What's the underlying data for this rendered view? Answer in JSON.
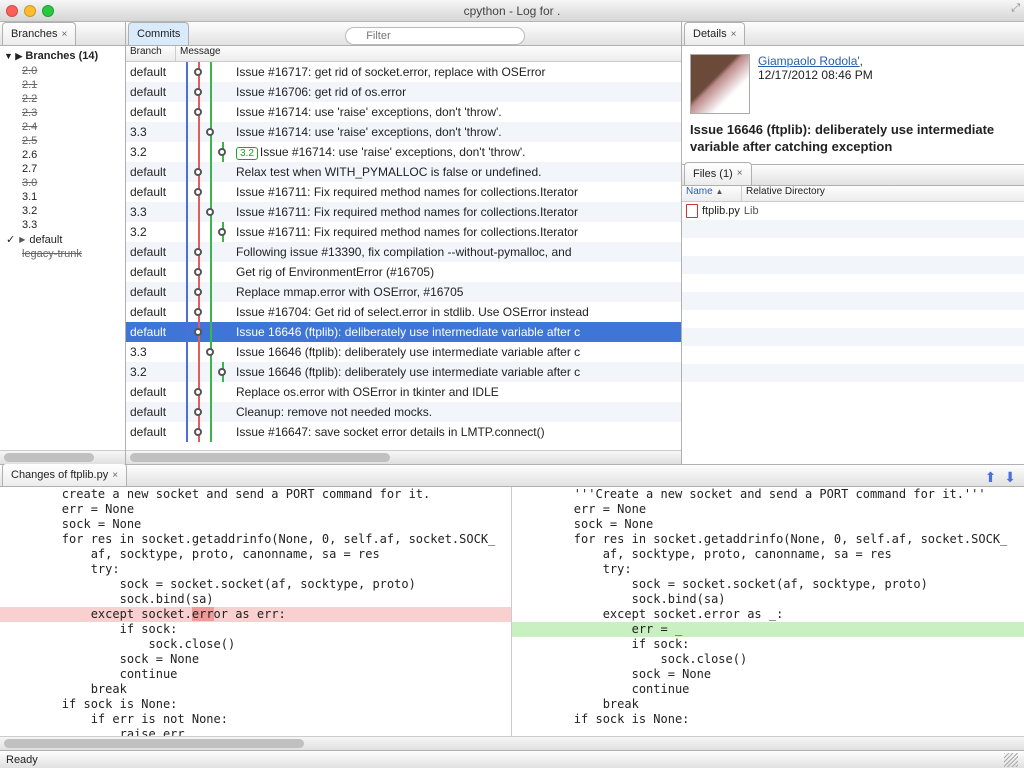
{
  "window": {
    "title": "cpython - Log for ."
  },
  "branches_panel": {
    "tab": "Branches",
    "header": "Branches (14)",
    "items": [
      {
        "label": "2.0",
        "strike": true
      },
      {
        "label": "2.1",
        "strike": true
      },
      {
        "label": "2.2",
        "strike": true
      },
      {
        "label": "2.3",
        "strike": true
      },
      {
        "label": "2.4",
        "strike": true
      },
      {
        "label": "2.5",
        "strike": true
      },
      {
        "label": "2.6",
        "strike": false
      },
      {
        "label": "2.7",
        "strike": false
      },
      {
        "label": "3.0",
        "strike": true
      },
      {
        "label": "3.1",
        "strike": false
      },
      {
        "label": "3.2",
        "strike": false
      },
      {
        "label": "3.3",
        "strike": false
      },
      {
        "label": "default",
        "strike": false,
        "checked": true,
        "disc": true
      },
      {
        "label": "legacy-trunk",
        "strike": true
      }
    ]
  },
  "commits_panel": {
    "tab": "Commits",
    "filter_placeholder": "Filter",
    "cols": {
      "branch": "Branch",
      "message": "Message"
    },
    "rows": [
      {
        "branch": "default",
        "msg": "Issue #16717: get rid of socket.error, replace with OSError",
        "node": 2
      },
      {
        "branch": "default",
        "msg": "Issue #16706: get rid of os.error",
        "node": 2
      },
      {
        "branch": "default",
        "msg": "Issue #16714: use 'raise' exceptions, don't 'throw'.",
        "node": 2
      },
      {
        "branch": "3.3",
        "msg": "Issue #16714: use 'raise' exceptions, don't 'throw'.",
        "node": 3
      },
      {
        "branch": "3.2",
        "badge": "3.2",
        "msg": "Issue #16714: use 'raise' exceptions, don't 'throw'.",
        "node": 4
      },
      {
        "branch": "default",
        "msg": "Relax test when WITH_PYMALLOC is false or undefined.",
        "node": 2
      },
      {
        "branch": "default",
        "msg": "Issue #16711: Fix required method names for collections.Iterator",
        "node": 2
      },
      {
        "branch": "3.3",
        "msg": "Issue #16711: Fix required method names for collections.Iterator",
        "node": 3
      },
      {
        "branch": "3.2",
        "msg": "Issue #16711: Fix required method names for collections.Iterator",
        "node": 4
      },
      {
        "branch": "default",
        "msg": "Following issue #13390, fix compilation --without-pymalloc, and",
        "node": 2
      },
      {
        "branch": "default",
        "msg": "Get rig of EnvironmentError (#16705)",
        "node": 2
      },
      {
        "branch": "default",
        "msg": "Replace mmap.error with OSError, #16705",
        "node": 2
      },
      {
        "branch": "default",
        "msg": "Issue #16704: Get rid of select.error in stdlib. Use OSError instead",
        "node": 2
      },
      {
        "branch": "default",
        "msg": "Issue 16646 (ftplib): deliberately use intermediate variable after c",
        "node": 2,
        "sel": true
      },
      {
        "branch": "3.3",
        "msg": "Issue 16646 (ftplib): deliberately use intermediate variable after c",
        "node": 3
      },
      {
        "branch": "3.2",
        "msg": "Issue 16646 (ftplib): deliberately use intermediate variable after c",
        "node": 4
      },
      {
        "branch": "default",
        "msg": "Replace os.error with OSError in tkinter and IDLE",
        "node": 2
      },
      {
        "branch": "default",
        "msg": "Cleanup: remove not needed mocks.",
        "node": 2
      },
      {
        "branch": "default",
        "msg": "Issue #16647: save socket error details in LMTP.connect()",
        "node": 2
      }
    ]
  },
  "details_panel": {
    "tab": "Details",
    "author": "Giampaolo Rodola'",
    "date": "12/17/2012 08:46 PM",
    "message": "Issue 16646 (ftplib): deliberately use intermediate variable after catching exception",
    "files_tab": "Files (1)",
    "files_cols": {
      "name": "Name",
      "dir": "Relative Directory"
    },
    "files": [
      {
        "name": "ftplib.py",
        "dir": "Lib"
      }
    ]
  },
  "diff_panel": {
    "tab": "Changes of ftplib.py",
    "left": [
      "        create a new socket and send a PORT command for it.",
      "        err = None",
      "        sock = None",
      "        for res in socket.getaddrinfo(None, 0, self.af, socket.SOCK_",
      "            af, socktype, proto, canonname, sa = res",
      "            try:",
      "                sock = socket.socket(af, socktype, proto)",
      "                sock.bind(sa)",
      {
        "del": "            except socket.error as err:",
        "mark": "err"
      },
      "                if sock:",
      "                    sock.close()",
      "                sock = None",
      "                continue",
      "            break",
      "        if sock is None:",
      "            if err is not None:",
      "                raise err"
    ],
    "right": [
      "        '''Create a new socket and send a PORT command for it.'''",
      "        err = None",
      "        sock = None",
      "        for res in socket.getaddrinfo(None, 0, self.af, socket.SOCK_",
      "            af, socktype, proto, canonname, sa = res",
      "            try:",
      "                sock = socket.socket(af, socktype, proto)",
      "                sock.bind(sa)",
      "            except socket.error as _:",
      {
        "add": "                err = _"
      },
      "                if sock:",
      "                    sock.close()",
      "                sock = None",
      "                continue",
      "            break",
      "        if sock is None:"
    ]
  },
  "status": "Ready"
}
